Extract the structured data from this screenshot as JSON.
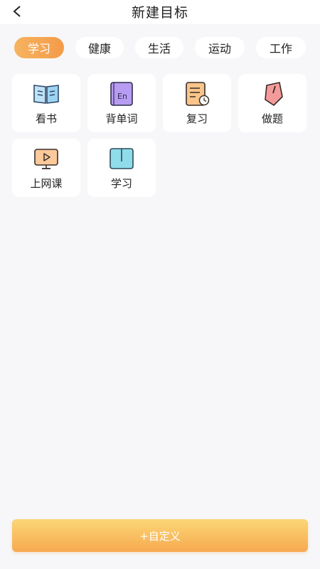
{
  "header": {
    "title": "新建目标"
  },
  "tabs": [
    {
      "label": "学习",
      "active": true
    },
    {
      "label": "健康",
      "active": false
    },
    {
      "label": "生活",
      "active": false
    },
    {
      "label": "运动",
      "active": false
    },
    {
      "label": "工作",
      "active": false
    }
  ],
  "items": [
    {
      "label": "看书",
      "icon": "book-icon"
    },
    {
      "label": "背单词",
      "icon": "vocabulary-icon",
      "icon_text": "En"
    },
    {
      "label": "复习",
      "icon": "review-notes-icon"
    },
    {
      "label": "做题",
      "icon": "exercise-icon"
    },
    {
      "label": "上网课",
      "icon": "online-class-icon"
    },
    {
      "label": "学习",
      "icon": "study-book-icon"
    }
  ],
  "custom_button": {
    "label": "+自定义"
  },
  "colors": {
    "accent": "#f49b4a",
    "button_top": "#fbd775",
    "button_bottom": "#f7a950"
  }
}
